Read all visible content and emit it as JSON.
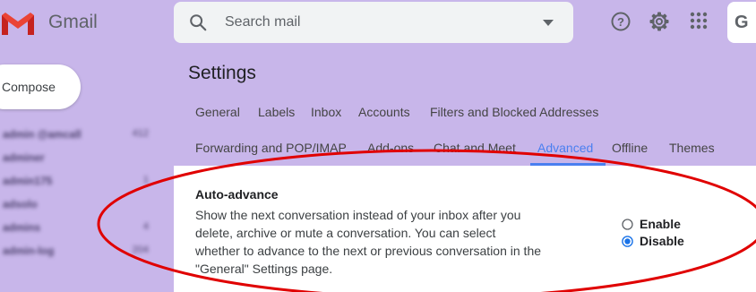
{
  "header": {
    "app_name": "Gmail",
    "search_placeholder": "Search mail",
    "avatar_letter": "G"
  },
  "sidebar": {
    "compose_label": "Compose",
    "items": [
      {
        "label": "admin @amcall",
        "count": "412"
      },
      {
        "label": "adminer",
        "count": ""
      },
      {
        "label": "admin175",
        "count": "1"
      },
      {
        "label": "adsolo",
        "count": ""
      },
      {
        "label": "admins",
        "count": "4"
      },
      {
        "label": "admin-log",
        "count": "204"
      }
    ]
  },
  "settings": {
    "title": "Settings",
    "tabs_row1": [
      "General",
      "Labels",
      "Inbox",
      "Accounts",
      "Filters and Blocked Addresses"
    ],
    "tabs_row2": [
      "Forwarding and POP/IMAP",
      "Add-ons",
      "Chat and Meet",
      "Advanced",
      "Offline",
      "Themes"
    ],
    "active_tab": "Advanced"
  },
  "auto_advance": {
    "title": "Auto-advance",
    "description": "Show the next conversation instead of your inbox after you delete, archive or mute a conversation. You can select whether to advance to the next or previous conversation in the \"General\" Settings page.",
    "options": [
      {
        "label": "Enable",
        "selected": false
      },
      {
        "label": "Disable",
        "selected": true
      }
    ]
  },
  "colors": {
    "background": "#c8b6ea",
    "accent": "#4a7ff0",
    "annotation": "#e00000"
  }
}
